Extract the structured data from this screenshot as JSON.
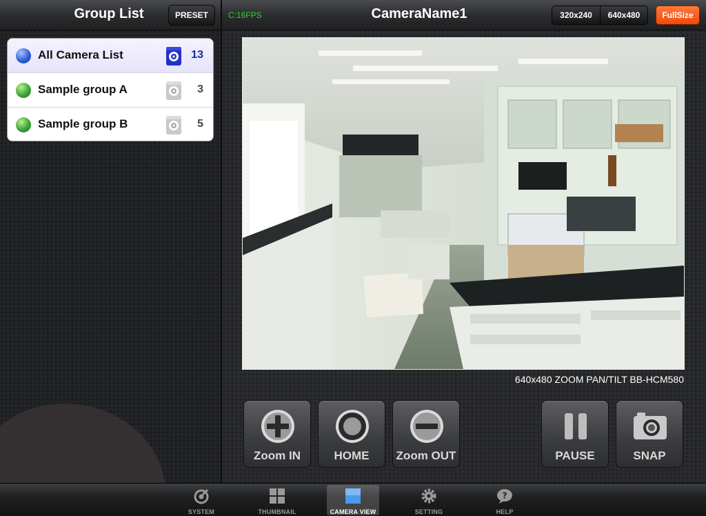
{
  "left": {
    "title": "Group List",
    "preset_label": "PRESET",
    "groups": [
      {
        "name": "All Camera List",
        "count": "13",
        "selected": true,
        "dot_color": "#2f5fd8"
      },
      {
        "name": "Sample group A",
        "count": "3",
        "selected": false,
        "dot_color": "#3ca53a"
      },
      {
        "name": "Sample group B",
        "count": "5",
        "selected": false,
        "dot_color": "#3ca53a"
      }
    ]
  },
  "viewer": {
    "fps": "C:16FPS",
    "camera_name": "CameraName1",
    "resolutions": [
      "320x240",
      "640x480"
    ],
    "fullsize_label": "FullSize",
    "caption": "640x480 ZOOM PAN/TILT BB-HCM580",
    "controls": {
      "zoom_in": "Zoom IN",
      "home": "HOME",
      "zoom_out": "Zoom OUT",
      "pause": "PAUSE",
      "snap": "SNAP"
    }
  },
  "tabs": [
    {
      "label": "SYSTEM",
      "icon": "system-icon"
    },
    {
      "label": "THUMBNAIL",
      "icon": "thumbnail-icon"
    },
    {
      "label": "CAMERA VIEW",
      "icon": "camera-view-icon",
      "active": true
    },
    {
      "label": "SETTING",
      "icon": "gear-icon"
    },
    {
      "label": "HELP",
      "icon": "help-icon"
    }
  ],
  "colors": {
    "fps_green": "#2fd42f",
    "fullsize_orange": "#ef4a0c",
    "selected_count_blue": "#1a2a9c"
  }
}
